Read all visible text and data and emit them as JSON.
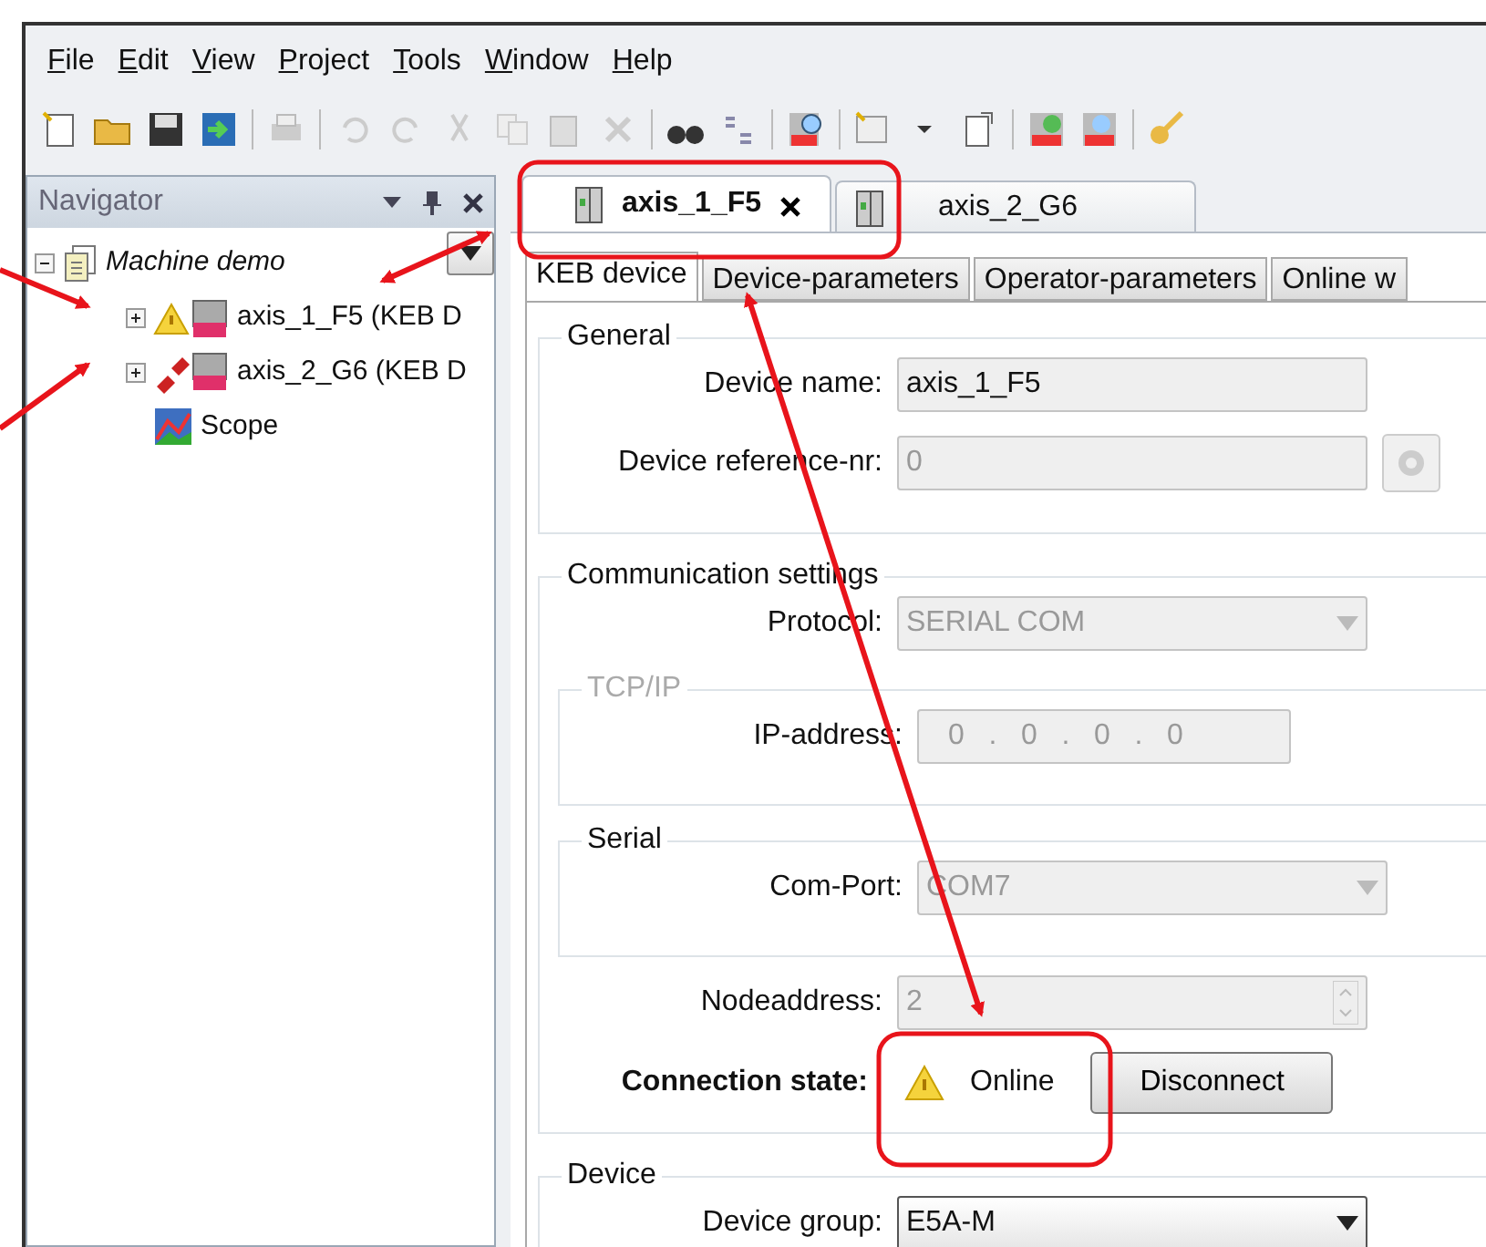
{
  "menu": [
    "File",
    "Edit",
    "View",
    "Project",
    "Tools",
    "Window",
    "Help"
  ],
  "navigator": {
    "title": "Navigator",
    "tree": [
      {
        "label": "Machine demo",
        "kind": "project",
        "expanded": true,
        "children": [
          {
            "label": "axis_1_F5 (KEB D",
            "kind": "device-warning",
            "expanded": false
          },
          {
            "label": "axis_2_G6 (KEB D",
            "kind": "device-disconnected",
            "expanded": false
          },
          {
            "label": "Scope",
            "kind": "scope"
          }
        ]
      }
    ]
  },
  "doc_tabs": [
    {
      "label": "axis_1_F5",
      "selected": true,
      "closable": true
    },
    {
      "label": "axis_2_G6",
      "selected": false,
      "closable": false
    }
  ],
  "sub_tabs": [
    {
      "label": "KEB device",
      "selected": true
    },
    {
      "label": "Device-parameters",
      "selected": false
    },
    {
      "label": "Operator-parameters",
      "selected": false
    },
    {
      "label": "Online w",
      "selected": false
    }
  ],
  "form": [
    {
      "kind": "group",
      "legend": "General",
      "disabled": false,
      "items": [
        {
          "kind": "text",
          "label": "Device name:",
          "value": "axis_1_F5",
          "disabled": false
        },
        {
          "kind": "text-button",
          "label": "Device reference-nr:",
          "value": "0",
          "disabled": true
        }
      ]
    },
    {
      "kind": "group",
      "legend": "Communication settings",
      "disabled": false,
      "items": [
        {
          "kind": "select",
          "label": "Protocol:",
          "value": "SERIAL COM",
          "disabled": true
        },
        {
          "kind": "group",
          "legend": "TCP/IP",
          "disabled": true,
          "items": [
            {
              "kind": "ip",
              "label": "IP-address:",
              "octets": [
                "0",
                "0",
                "0",
                "0"
              ],
              "separator": ".",
              "disabled": true
            }
          ]
        },
        {
          "kind": "group",
          "legend": "Serial",
          "disabled": false,
          "items": [
            {
              "kind": "select",
              "label": "Com-Port:",
              "value": "COM7",
              "disabled": true
            }
          ]
        },
        {
          "kind": "spin",
          "label": "Nodeaddress:",
          "value": "2",
          "disabled": true
        },
        {
          "kind": "connection",
          "label": "Connection state:",
          "status": "Online",
          "button": "Disconnect"
        }
      ]
    },
    {
      "kind": "group",
      "legend": "Device",
      "disabled": false,
      "items": [
        {
          "kind": "select",
          "label": "Device group:",
          "value": "E5A-M",
          "disabled": false
        }
      ]
    }
  ]
}
